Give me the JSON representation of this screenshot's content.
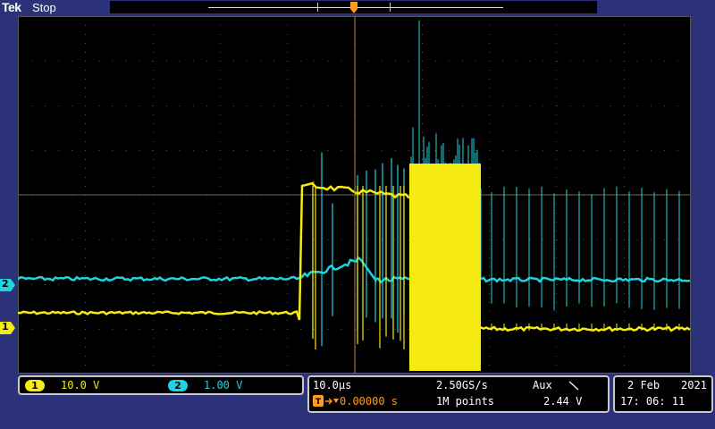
{
  "header": {
    "brand": "Tek",
    "run_state": "Stop"
  },
  "trigger": {
    "marker_label": "T"
  },
  "channels": [
    {
      "number": "1",
      "scale": "10.0 V",
      "color": "#f5ea12"
    },
    {
      "number": "2",
      "scale": "1.00 V",
      "color": "#1fd3e0"
    }
  ],
  "timebase": {
    "scale": "10.0µs",
    "delay": "0.00000 s",
    "sample_rate": "2.50GS/s",
    "record_length": "1M points"
  },
  "trigger_info": {
    "source": "Aux",
    "slope_icon": "falling-edge-icon",
    "level": "2.44 V"
  },
  "datetime": {
    "date": "2 Feb",
    "year": "2021",
    "time": "17: 06: 11"
  },
  "colors": {
    "background": "#2b3278",
    "grid": "#555555",
    "trigger": "#ff9a1a"
  }
}
